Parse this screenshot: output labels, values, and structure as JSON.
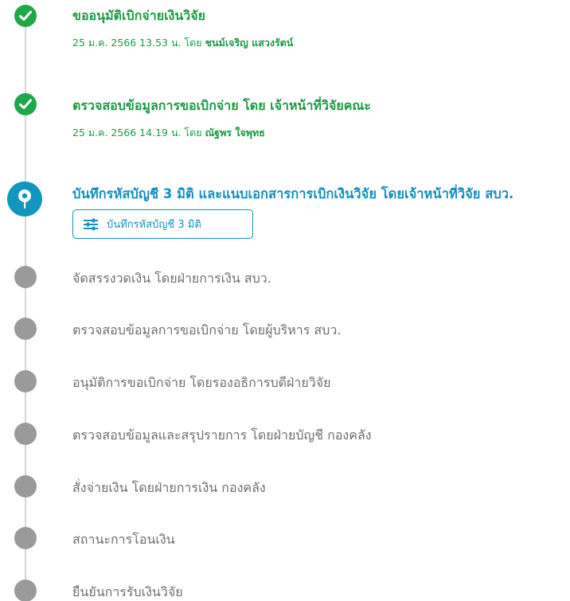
{
  "steps": [
    {
      "status": "done",
      "title": "ขออนุมัติเบิกจ่ายเงินวิจัย",
      "meta_prefix": "25 ม.ค. 2566 13.53 น. โดย",
      "meta_person": "ชนม์เจริญ แสวงรัตน์"
    },
    {
      "status": "done",
      "title": "ตรวจสอบข้อมูลการขอเบิกจ่าย โดย เจ้าหน้าที่วิจัยคณะ",
      "meta_prefix": "25 ม.ค. 2566 14.19 น. โดย",
      "meta_person": "ณัฐพร ใจพุทธ"
    },
    {
      "status": "current",
      "title": "บันทึกรหัสบัญชี 3 มิติ และแนบเอกสารการเบิกเงินวิจัย โดยเจ้าหน้าที่วิจัย สบว.",
      "action_label": "บันทึกรหัสบัญชี 3 มิติ"
    },
    {
      "status": "pending",
      "title": "จัดสรรงวดเงิน โดยฝ่ายการเงิน สบว."
    },
    {
      "status": "pending",
      "title": "ตรวจสอบข้อมูลการขอเบิกจ่าย โดยผู้บริหาร สบว."
    },
    {
      "status": "pending",
      "title": "อนุมัติการขอเบิกจ่าย โดยรองอธิการบดีฝ่ายวิจัย"
    },
    {
      "status": "pending",
      "title": "ตรวจสอบข้อมูลและสรุปรายการ โดยฝ่ายบัญชี กองคลัง"
    },
    {
      "status": "pending",
      "title": "สั่งจ่ายเงิน โดยฝ่ายการเงิน กองคลัง"
    },
    {
      "status": "pending",
      "title": "สถานะการโอนเงิน"
    },
    {
      "status": "pending",
      "title": "ยืนยันการรับเงินวิจัย"
    }
  ],
  "icons": {
    "done": "check-icon",
    "current": "location-pin-icon",
    "action": "sliders-icon"
  },
  "colors": {
    "done": "#1e9a45",
    "current": "#1690bd",
    "pending": "#9a9a9a",
    "line": "#d6d6d6"
  }
}
